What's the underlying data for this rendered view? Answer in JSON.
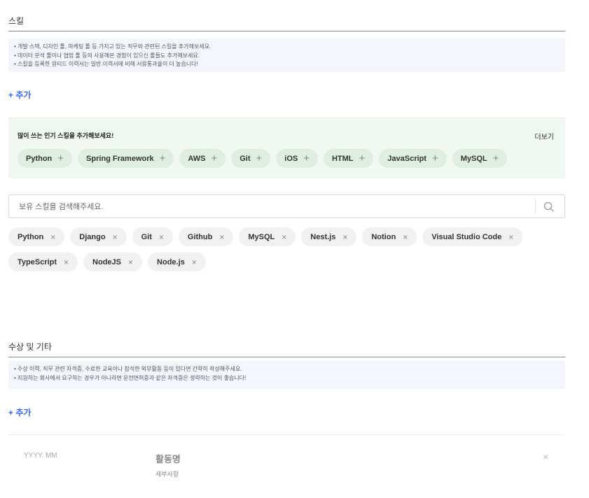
{
  "skills_section": {
    "title": "스킬",
    "guide": [
      "• 개발 스택, 디자인 툴, 마케팅 툴 등 가지고 있는 직무와 관련된 스킬을 추가해보세요.",
      "• 데이터 분석 툴이나 협업 툴 등의 사용해본 경험이 있으신 툴들도 추가해보세요.",
      "• 스킬을 등록한 원티드 이력서는 일반 이력서에 비해 서류통과율이 더 높습니다!"
    ],
    "add_label": "+ 추가",
    "popular": {
      "title": "많이 쓰는 인기 스킬을 추가해보세요!",
      "more_label": "더보기",
      "chips": [
        "Python",
        "Spring Framework",
        "AWS",
        "Git",
        "iOS",
        "HTML",
        "JavaScript",
        "MySQL"
      ]
    },
    "search": {
      "placeholder": "보유 스킬을 검색해주세요."
    },
    "selected": [
      "Python",
      "Django",
      "Git",
      "Github",
      "MySQL",
      "Nest.js",
      "Notion",
      "Visual Studio Code",
      "TypeScript",
      "NodeJS",
      "Node.js"
    ]
  },
  "awards_section": {
    "title": "수상 및 기타",
    "guide": [
      "• 수상 이력, 직무 관련 자격증, 수료한 교육이나 참석한 외부활동 등이 있다면 간략히 작성해주세요.",
      "• 지원하는 회사에서 요구하는 경우가 아니라면 운전면허증과 같은 자격증은 생략하는 것이 좋습니다!"
    ],
    "add_label": "+ 추가",
    "entry": {
      "date_placeholder": "YYYY. MM",
      "title_placeholder": "활동명",
      "detail_placeholder": "세부사항",
      "close_symbol": "×"
    }
  },
  "icons": {
    "plus": "+",
    "remove": "×",
    "search": "search-icon"
  }
}
